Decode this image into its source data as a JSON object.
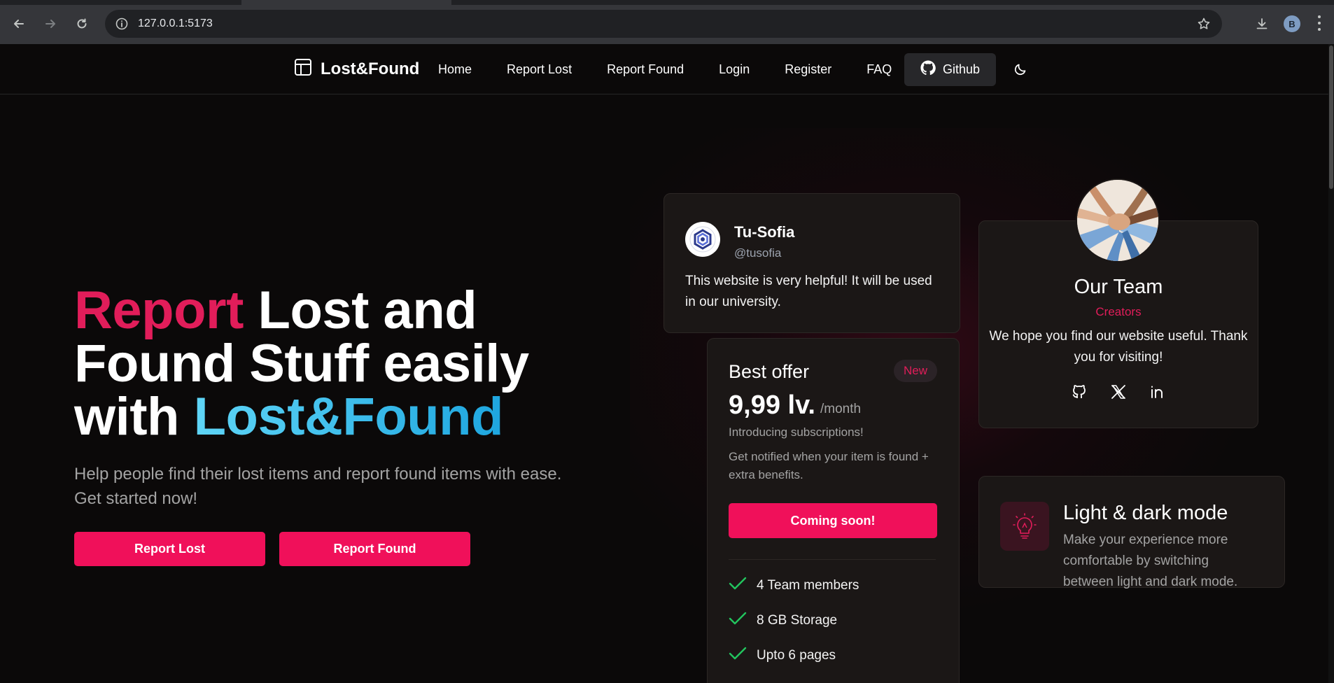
{
  "browser": {
    "url": "127.0.0.1:5173",
    "profile_initial": "B"
  },
  "nav": {
    "brand": "Lost&Found",
    "links": [
      "Home",
      "Report Lost",
      "Report Found",
      "Login",
      "Register",
      "FAQ"
    ],
    "github_label": "Github"
  },
  "hero": {
    "title_pink": "Report",
    "title_white": "Lost and Found Stuff easily with",
    "title_cyan": "Lost&Found",
    "subtitle": "Help people find their lost items and report found items with ease. Get started now!",
    "btn_report_lost": "Report Lost",
    "btn_report_found": "Report Found"
  },
  "testimonial": {
    "name": "Tu-Sofia",
    "handle": "@tusofia",
    "text": "This website is very helpful! It will be used in our university."
  },
  "offer": {
    "title": "Best offer",
    "badge": "New",
    "price": "9,99 lv.",
    "period": "/month",
    "line1": "Introducing subscriptions!",
    "line2": "Get notified when your item is found + extra benefits.",
    "button": "Coming soon!",
    "features": [
      "4 Team members",
      "8 GB Storage",
      "Upto 6 pages"
    ]
  },
  "team": {
    "title": "Our Team",
    "role": "Creators",
    "text": "We hope you find our website useful. Thank you for visiting!",
    "socials": [
      "github-icon",
      "x-icon",
      "linkedin-icon"
    ]
  },
  "feature_card": {
    "title": "Light & dark mode",
    "text": "Make your experience more comfortable by switching between light and dark mode."
  },
  "colors": {
    "accent_pink": "#f0105a",
    "accent_cyan": "#1ea6df",
    "check_green": "#22c55e"
  }
}
